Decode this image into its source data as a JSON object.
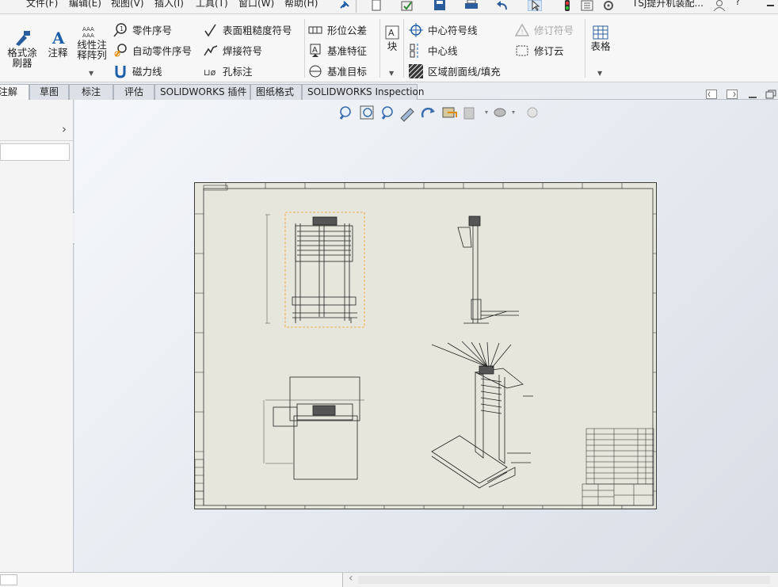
{
  "menubar": {
    "items": [
      "文件(F)",
      "编辑(E)",
      "视图(V)",
      "插入(I)",
      "工具(T)",
      "窗口(W)",
      "帮助(H)"
    ],
    "doc_title": "TSJ提升机装配..."
  },
  "ribbon": {
    "format_painter": "格式涂\n刷器",
    "note": "注释",
    "linear_note_pattern": "线性注\n释阵列",
    "balloon": "零件序号",
    "auto_balloon": "自动零件序号",
    "magnetic_line": "磁力线",
    "surface_finish": "表面粗糙度符号",
    "weld_symbol": "焊接符号",
    "hole_callout": "孔标注",
    "gtol": "形位公差",
    "datum_feature": "基准特征",
    "datum_target": "基准目标",
    "blocks": "块",
    "center_mark": "中心符号线",
    "centerline": "中心线",
    "area_hatch": "区域剖面线/填充",
    "revision_symbol": "修订符号",
    "revision_cloud": "修订云",
    "tables": "表格"
  },
  "tabs": [
    "注解",
    "草图",
    "标注",
    "评估",
    "SOLIDWORKS 插件",
    "图纸格式",
    "SOLIDWORKS Inspection"
  ],
  "colors": {
    "sheet_bg": "#e6e6dc",
    "selection_box": "#f0a020",
    "accent_blue": "#1c5ea8"
  },
  "icons": {
    "heads_up": [
      "zoom-to-fit-icon",
      "zoom-area-icon",
      "previous-view-icon",
      "section-view-icon",
      "rotate-icon",
      "display-style-icon",
      "hide-show-icon",
      "appearance-icon",
      "scene-icon"
    ]
  }
}
